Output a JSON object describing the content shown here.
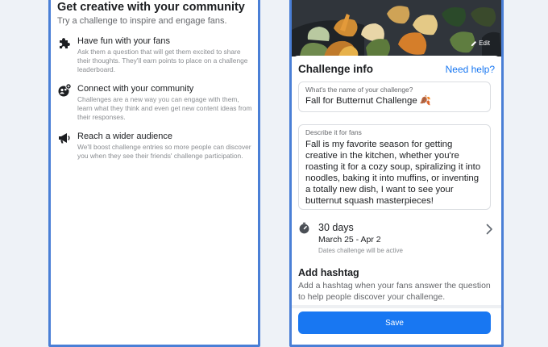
{
  "left": {
    "title": "Get creative with your community",
    "subtitle": "Try a challenge to inspire and engage fans.",
    "features": [
      {
        "icon": "puzzle-icon",
        "title": "Have fun with your fans",
        "description": "Ask them a question that will get them excited to share their thoughts. They'll earn points to place on a challenge leaderboard."
      },
      {
        "icon": "community-icon",
        "title": "Connect with your community",
        "description": "Challenges are a new way you can engage with them, learn what they think and even get new content ideas from their responses."
      },
      {
        "icon": "megaphone-icon",
        "title": "Reach a wider audience",
        "description": "We'll boost challenge entries so more people can discover you when they see their friends' challenge participation."
      }
    ]
  },
  "right": {
    "photo": {
      "edit_label": "Edit"
    },
    "challenge_info": {
      "title": "Challenge info",
      "help_link": "Need help?"
    },
    "name_field": {
      "label": "What's the name of your challenge?",
      "value": "Fall for Butternut Challenge 🍂"
    },
    "description_field": {
      "label": "Describe it for fans",
      "value": "Fall is my favorite season for getting creative in the kitchen, whether you're roasting it for a cozy soup, spiralizing it into noodles, baking it into muffins, or inventing a totally new dish, I want to see your butternut squash masterpieces!"
    },
    "duration": {
      "days": "30 days",
      "dates": "March 25 - Apr 2",
      "note": "Dates challenge will be active"
    },
    "hashtag": {
      "title": "Add hashtag",
      "description": "Add a hashtag when your fans answer the question to help people discover your challenge."
    },
    "save_label": "Save"
  },
  "colors": {
    "frame_border": "#4a7fd6",
    "accent": "#1877f2",
    "background": "#eef2f7"
  }
}
